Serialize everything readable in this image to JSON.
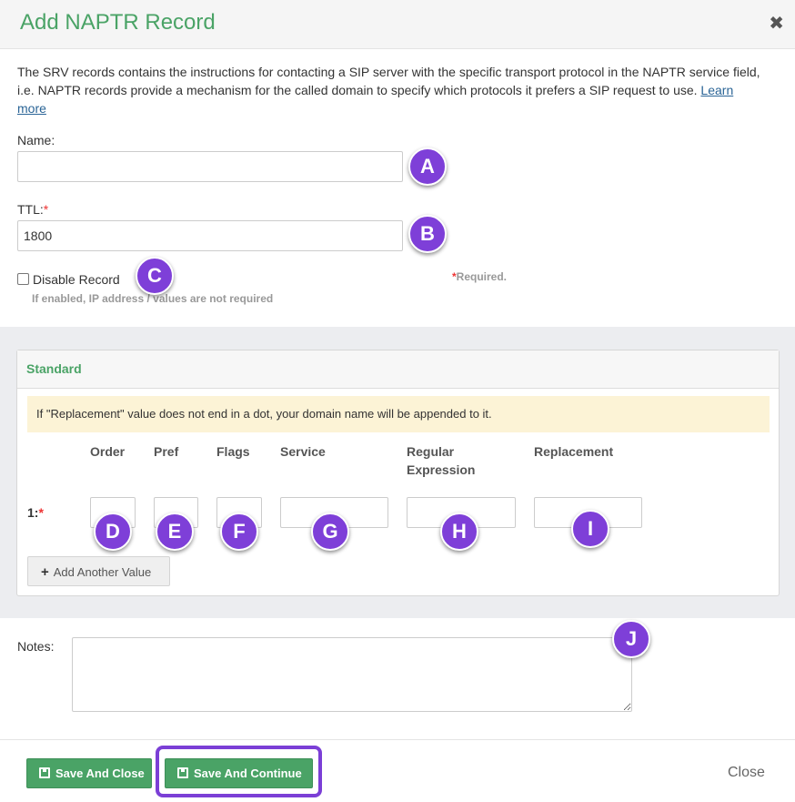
{
  "dialog": {
    "title": "Add NAPTR Record",
    "close_icon": "close-icon"
  },
  "description": {
    "text": "The SRV records contains the instructions for contacting a SIP server with the specific transport protocol in the NAPTR service field, i.e. NAPTR records provide a mechanism for the called domain to specify which protocols it prefers a SIP request to use.",
    "link": "Learn more"
  },
  "form": {
    "name_label": "Name:",
    "name_value": "",
    "ttl_label": "TTL:",
    "required_mark": "*",
    "ttl_value": "1800",
    "disable_label": "Disable Record",
    "disable_checked": false,
    "disable_hint": "If enabled, IP address / values are not required",
    "required_star": "*",
    "required_note": "Required."
  },
  "standard": {
    "heading": "Standard",
    "alert": "If \"Replacement\" value does not end in a dot, your domain name will be appended to it.",
    "columns": [
      "Order",
      "Pref",
      "Flags",
      "Service",
      "Regular\nExpression",
      "Replacement"
    ],
    "row_label": "1:",
    "row_required": "*",
    "add_button": "Add Another Value"
  },
  "notes": {
    "label": "Notes:",
    "value": ""
  },
  "footer": {
    "save_close": "Save And Close",
    "save_continue": "Save And Continue",
    "close": "Close"
  },
  "markers": [
    "A",
    "B",
    "C",
    "D",
    "E",
    "F",
    "G",
    "H",
    "I",
    "J"
  ],
  "colors": {
    "accent_green": "#4aa366",
    "marker_purple": "#7e3fd8",
    "alert_bg": "#fcf3d6",
    "required_red": "#e33333"
  }
}
